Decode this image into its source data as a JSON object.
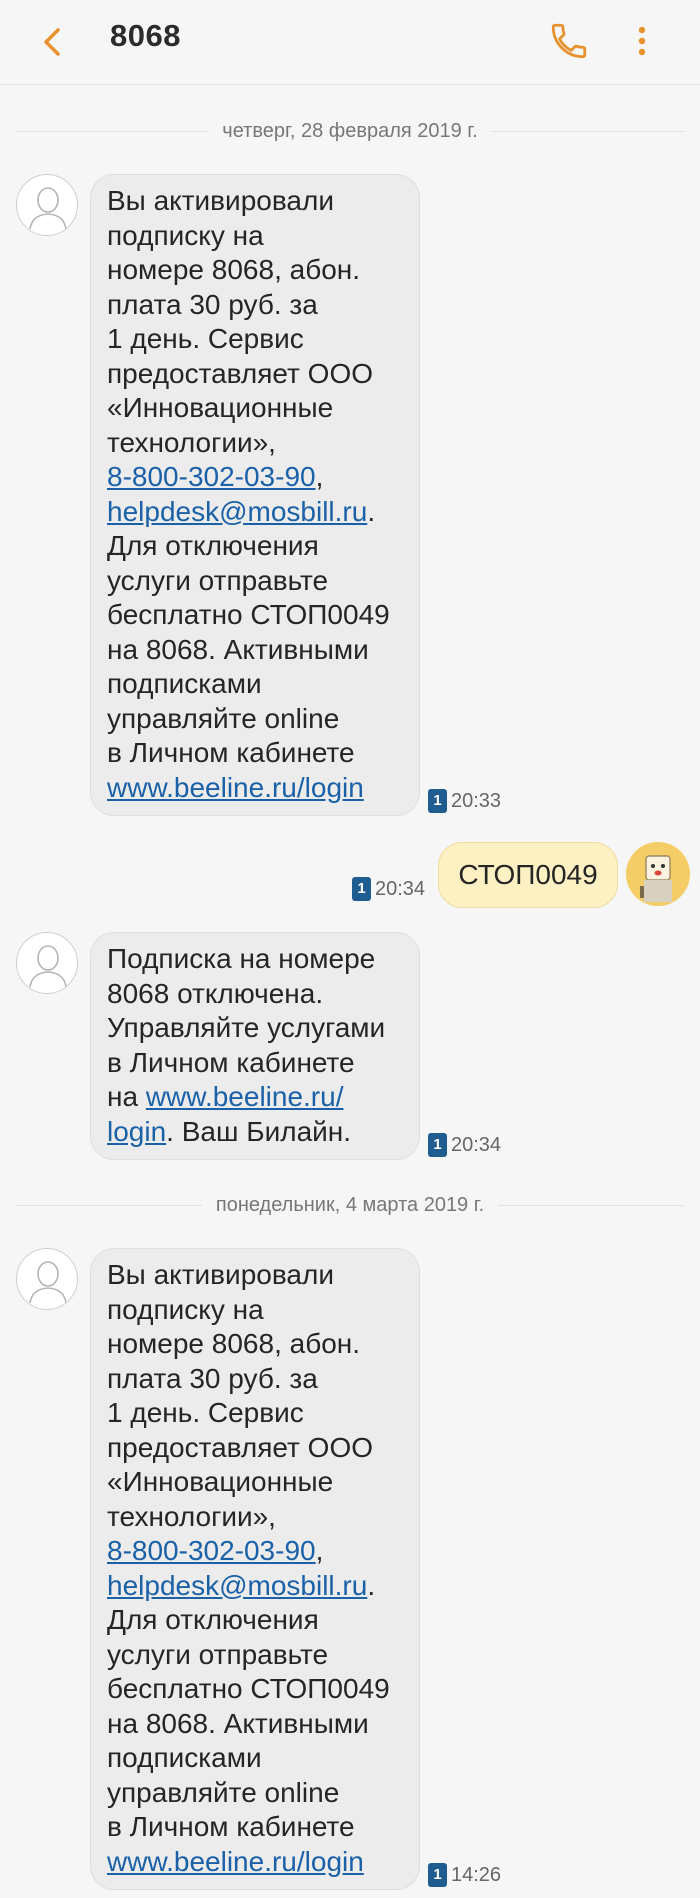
{
  "header": {
    "title": "8068",
    "icons": {
      "back": "chevron-left-icon",
      "call": "phone-icon",
      "more": "more-vertical-icon"
    },
    "accent": "#e8922f"
  },
  "date_separators": [
    "четверг, 28 февраля 2019 г.",
    "понедельник, 4 марта 2019 г."
  ],
  "sim_label": "1",
  "messages": [
    {
      "id": "m1",
      "dir": "in",
      "time": "20:33",
      "lines": [
        "Вы активировали",
        "подписку на",
        "номере 8068, абон.",
        "плата 30 руб. за",
        "1 день. Сервис",
        "предоставляет ООО",
        "«Инновационные",
        "технологии»,"
      ],
      "phone": "8-800-302-03-90",
      "email": "helpdesk@mosbill.ru",
      "lines2": [
        "Для отключения",
        "услуги отправьте",
        "бесплатно СТОП0049",
        "на 8068. Активными",
        "подписками",
        "управляйте online",
        "в Личном кабинете"
      ],
      "url": "www.beeline.ru/login"
    },
    {
      "id": "m2",
      "dir": "out",
      "time": "20:34",
      "text": "СТОП0049"
    },
    {
      "id": "m3",
      "dir": "in",
      "time": "20:34",
      "lines": [
        "Подписка на номере",
        "8068 отключена.",
        "Управляйте услугами",
        "в Личном кабинете"
      ],
      "prefix": "на",
      "url_part1": "www.beeline.ru/",
      "url_part2": "login",
      "suffix": ". Ваш Билайн."
    },
    {
      "id": "m4",
      "dir": "in",
      "time": "14:26",
      "lines": [
        "Вы активировали",
        "подписку на",
        "номере 8068, абон.",
        "плата 30 руб. за",
        "1 день. Сервис",
        "предоставляет ООО",
        "«Инновационные",
        "технологии»,"
      ],
      "phone": "8-800-302-03-90",
      "email": "helpdesk@mosbill.ru",
      "lines2": [
        "Для отключения",
        "услуги отправьте",
        "бесплатно СТОП0049",
        "на 8068. Активными",
        "подписками",
        "управляйте online",
        "в Личном кабинете"
      ],
      "url": "www.beeline.ru/login"
    }
  ]
}
